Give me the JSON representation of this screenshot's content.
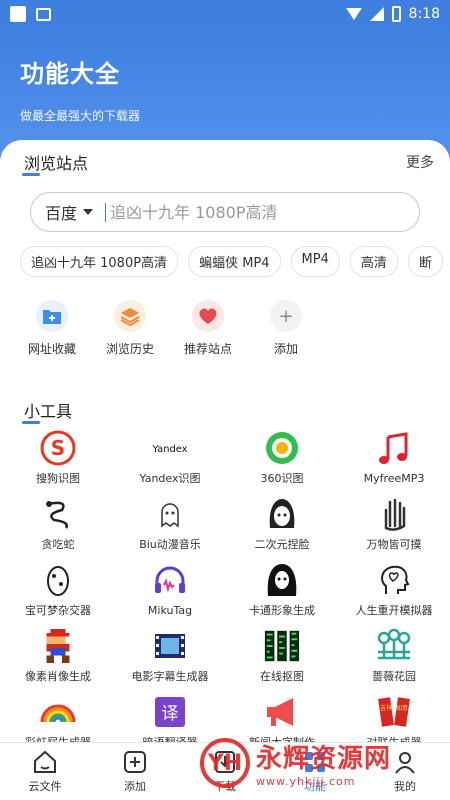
{
  "status_bar": {
    "time": "8:18"
  },
  "header": {
    "title": "功能大全",
    "subtitle": "做最全最强大的下载器"
  },
  "browse": {
    "title": "浏览站点",
    "more": "更多",
    "engine": "百度",
    "search_placeholder": "追凶十九年 1080P高清",
    "tags": [
      "追凶十九年 1080P高清",
      "蝙蝠侠 MP4",
      "MP4",
      "高清",
      "断"
    ]
  },
  "quick_actions": [
    {
      "label": "网址收藏",
      "icon": "folder-plus-icon",
      "bg": "#e6f1fd"
    },
    {
      "label": "浏览历史",
      "icon": "layers-icon",
      "bg": "#fdeee0"
    },
    {
      "label": "推荐站点",
      "icon": "heart-icon",
      "bg": "#fde6e6"
    },
    {
      "label": "添加",
      "icon": "plus-icon",
      "bg": "#f3f3f3"
    }
  ],
  "tools": {
    "title": "小工具",
    "items": [
      {
        "label": "搜狗识图",
        "icon": "sogou-icon"
      },
      {
        "label": "Yandex识图",
        "icon": "yandex-icon"
      },
      {
        "label": "360识图",
        "icon": "360-icon"
      },
      {
        "label": "MyfreeMP3",
        "icon": "music-note-icon"
      },
      {
        "label": "贪吃蛇",
        "icon": "snake-icon"
      },
      {
        "label": "Biu动漫音乐",
        "icon": "ghost-icon"
      },
      {
        "label": "二次元捏脸",
        "icon": "anime-face-icon"
      },
      {
        "label": "万物皆可摸",
        "icon": "hand-icon"
      },
      {
        "label": "宝可梦杂交器",
        "icon": "egg-icon"
      },
      {
        "label": "MikuTag",
        "icon": "headphones-icon"
      },
      {
        "label": "卡通形象生成",
        "icon": "cartoon-face-icon"
      },
      {
        "label": "人生重开模拟器",
        "icon": "head-heart-icon"
      },
      {
        "label": "像素肖像生成",
        "icon": "pixel-mario-icon"
      },
      {
        "label": "电影字幕生成器",
        "icon": "film-icon"
      },
      {
        "label": "在线抠图",
        "icon": "matrix-icon"
      },
      {
        "label": "蔷薇花园",
        "icon": "garden-icon"
      },
      {
        "label": "彩虹屁生成器",
        "icon": "rainbow-icon"
      },
      {
        "label": "暗语翻译器",
        "icon": "translate-icon"
      },
      {
        "label": "新闻大字制作",
        "icon": "megaphone-icon"
      },
      {
        "label": "对联生成器",
        "icon": "couplet-icon"
      }
    ]
  },
  "tabbar": [
    {
      "label": "云文件",
      "icon": "home-cloud-icon"
    },
    {
      "label": "添加",
      "icon": "add-box-icon"
    },
    {
      "label": "下载",
      "icon": "download-icon"
    },
    {
      "label": "功能",
      "icon": "function-icon"
    },
    {
      "label": "我的",
      "icon": "user-icon"
    }
  ],
  "watermark": {
    "logo": "YH",
    "name": "永辉资源网",
    "url": "www.yhkjjj.com"
  },
  "colors": {
    "primary": "#3f7fe0"
  }
}
